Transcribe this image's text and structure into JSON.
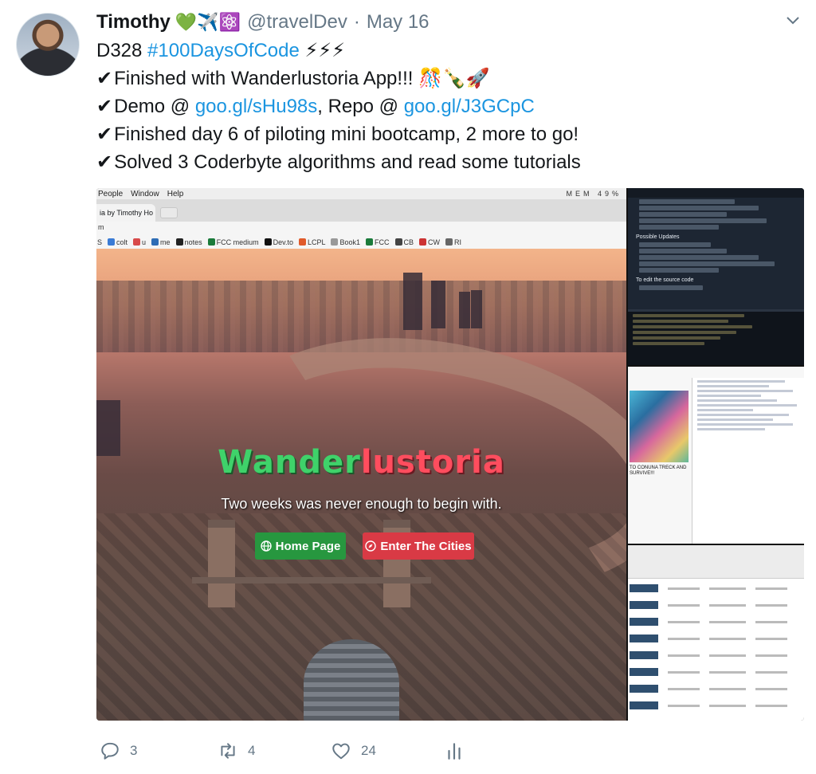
{
  "tweet": {
    "author_name": "Timothy",
    "name_emojis": "💚✈️⚛️",
    "handle": "@travelDev",
    "separator": "·",
    "date": "May 16",
    "lines": [
      {
        "prefix": "D328 ",
        "hashtag": "#100DaysOfCode",
        "suffix": " ⚡⚡⚡"
      },
      {
        "check": "✔",
        "text": "Finished with Wanderlustoria App!!! 🎊🍾🚀"
      },
      {
        "check": "✔",
        "pre": "Demo @ ",
        "link1": "goo.gl/sHu98s",
        "mid": ", Repo @ ",
        "link2": "goo.gl/J3GCpC"
      },
      {
        "check": "✔",
        "text": "Finished day 6 of piloting mini bootcamp, 2 more to go!"
      },
      {
        "check": "✔",
        "text": "Solved 3 Coderbyte algorithms and read some tutorials"
      }
    ]
  },
  "media": {
    "menubar": [
      "People",
      "Window",
      "Help"
    ],
    "menubar_right": "MEM 49%",
    "tab_label": "ia by Timothy Ho",
    "tab_close": "×",
    "address": "m",
    "bookmarks": [
      "S",
      "colt",
      "u",
      "me",
      "notes",
      "FCC medium",
      "Dev.to",
      "LCPL",
      "Book1",
      "FCC",
      "CB",
      "CW",
      "RI"
    ],
    "hero_title_part1": "Wander",
    "hero_title_part2": "lustoria",
    "hero_subtitle": "Two weeks was never enough to begin with.",
    "btn_home": "Home Page",
    "btn_enter": "Enter The Cities",
    "editor_section_1": "Possible Updates",
    "editor_section_2": "To edit the source code",
    "side_caption": "TO CONUNA TRECK AND SURVIVE!!!"
  },
  "actions": {
    "replies": "3",
    "retweets": "4",
    "likes": "24"
  },
  "colors": {
    "link": "#1b95e0",
    "meta": "#657786",
    "btn_home": "#27973f",
    "btn_enter": "#d93a45"
  }
}
